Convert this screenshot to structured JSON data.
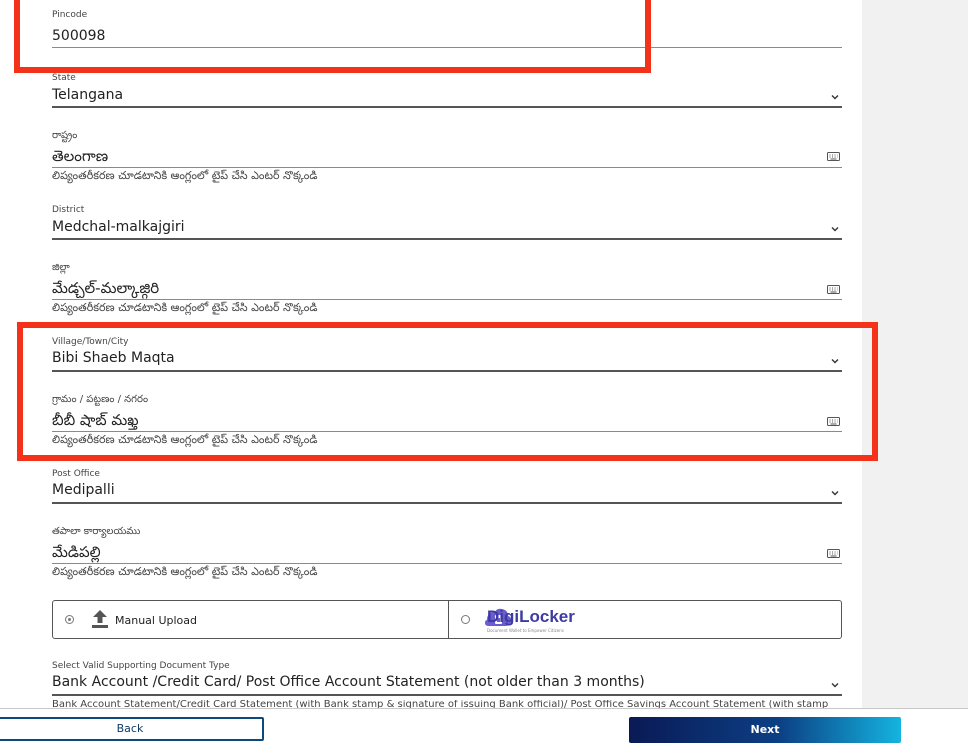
{
  "form": {
    "pincode": {
      "label": "Pincode",
      "value": "500098"
    },
    "state": {
      "label": "State",
      "value": "Telangana"
    },
    "state_te": {
      "label": "రాష్ట్రం",
      "value": "తెలంగాణ",
      "hint": "లిప్యంతరీకరణ చూడటానికి ఆంగ్లంలో టైప్ చేసి ఎంటర్ నొక్కండి"
    },
    "district": {
      "label": "District",
      "value": "Medchal-malkajgiri"
    },
    "district_te": {
      "label": "జిల్లా",
      "value": "మేడ్చల్-మల్కాజ్గిరి",
      "hint": "లిప్యంతరీకరణ చూడటానికి ఆంగ్లంలో టైప్ చేసి ఎంటర్ నొక్కండి"
    },
    "village": {
      "label": "Village/Town/City",
      "value": "Bibi Shaeb Maqta"
    },
    "village_te": {
      "label": "గ్రామం / పట్టణం / నగరం",
      "value": "బీబీ షాబ్ మఖ్త",
      "hint": "లిప్యంతరీకరణ చూడటానికి ఆంగ్లంలో టైప్ చేసి ఎంటర్ నొక్కండి"
    },
    "post_office": {
      "label": "Post Office",
      "value": "Medipalli"
    },
    "post_office_te": {
      "label": "తపాలా కార్యాలయము",
      "value": "మేడిపల్లి",
      "hint": "లిప్యంతరీకరణ చూడటానికి ఆంగ్లంలో టైప్ చేసి ఎంటర్ నొక్కండి"
    },
    "upload": {
      "manual_label": "Manual Upload",
      "manual_selected": true,
      "digilocker_label": "DigiLocker",
      "digilocker_tagline": "Document Wallet to Empower Citizens",
      "digilocker_selected": false
    },
    "doc_type": {
      "label": "Select Valid Supporting Document Type",
      "value": "Bank Account /Credit Card/ Post Office Account Statement (not older than 3 months)",
      "description": "Bank Account Statement/Credit Card Statement (with Bank stamp & signature of issuing Bank official)/ Post Office Savings Account Statement (with stamp"
    }
  },
  "footer": {
    "back_label": "Back",
    "next_label": "Next"
  },
  "colors": {
    "highlight": "#f4321a",
    "brand": "#0d4a7c",
    "digilocker": "#3d3ba3"
  },
  "icons": {
    "dropdown": "chevron-down-icon",
    "keyboard": "keyboard-icon",
    "upload": "upload-arrow-icon",
    "digilocker": "digilocker-logo-icon"
  }
}
